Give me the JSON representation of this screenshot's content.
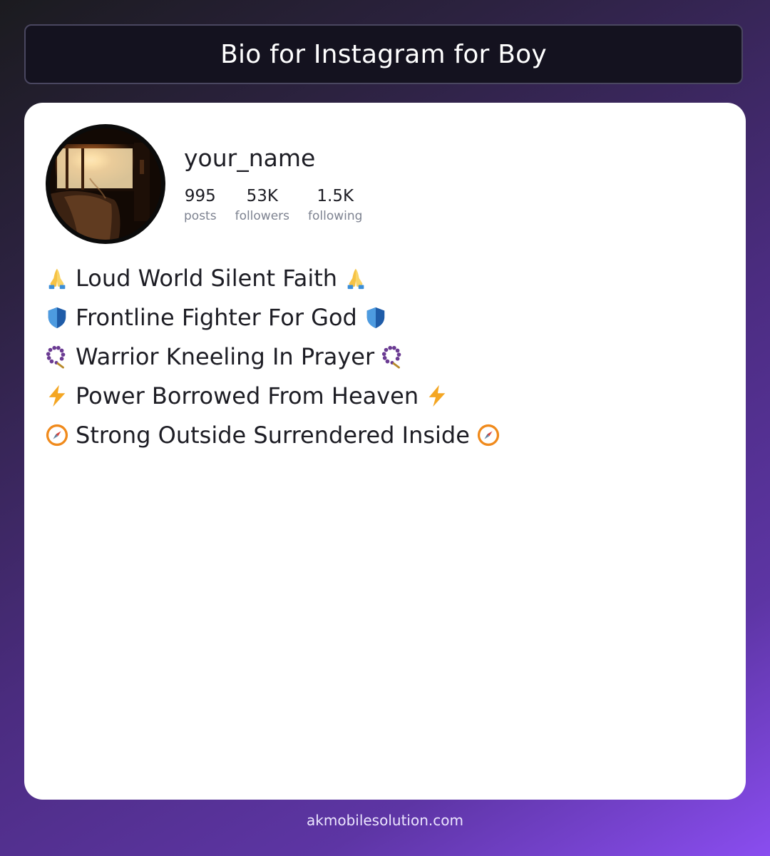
{
  "header": {
    "title": "Bio for Instagram for Boy"
  },
  "profile": {
    "username": "your_name",
    "stats": [
      {
        "value": "995",
        "label": "posts"
      },
      {
        "value": "53K",
        "label": "followers"
      },
      {
        "value": "1.5K",
        "label": "following"
      }
    ]
  },
  "bio": {
    "lines": [
      {
        "text": "Loud World Silent Faith",
        "icon": "folded-hands-icon"
      },
      {
        "text": "Frontline Fighter For God",
        "icon": "shield-icon"
      },
      {
        "text": "Warrior Kneeling In Prayer",
        "icon": "prayer-beads-icon"
      },
      {
        "text": "Power Borrowed From Heaven",
        "icon": "lightning-icon"
      },
      {
        "text": "Strong Outside Surrendered Inside",
        "icon": "compass-icon"
      }
    ]
  },
  "footer": {
    "site": "akmobilesolution.com"
  },
  "colors": {
    "card_bg": "#ffffff",
    "title_bar_bg": "#14121f",
    "text": "#1d1d24",
    "muted": "#7d8290"
  }
}
